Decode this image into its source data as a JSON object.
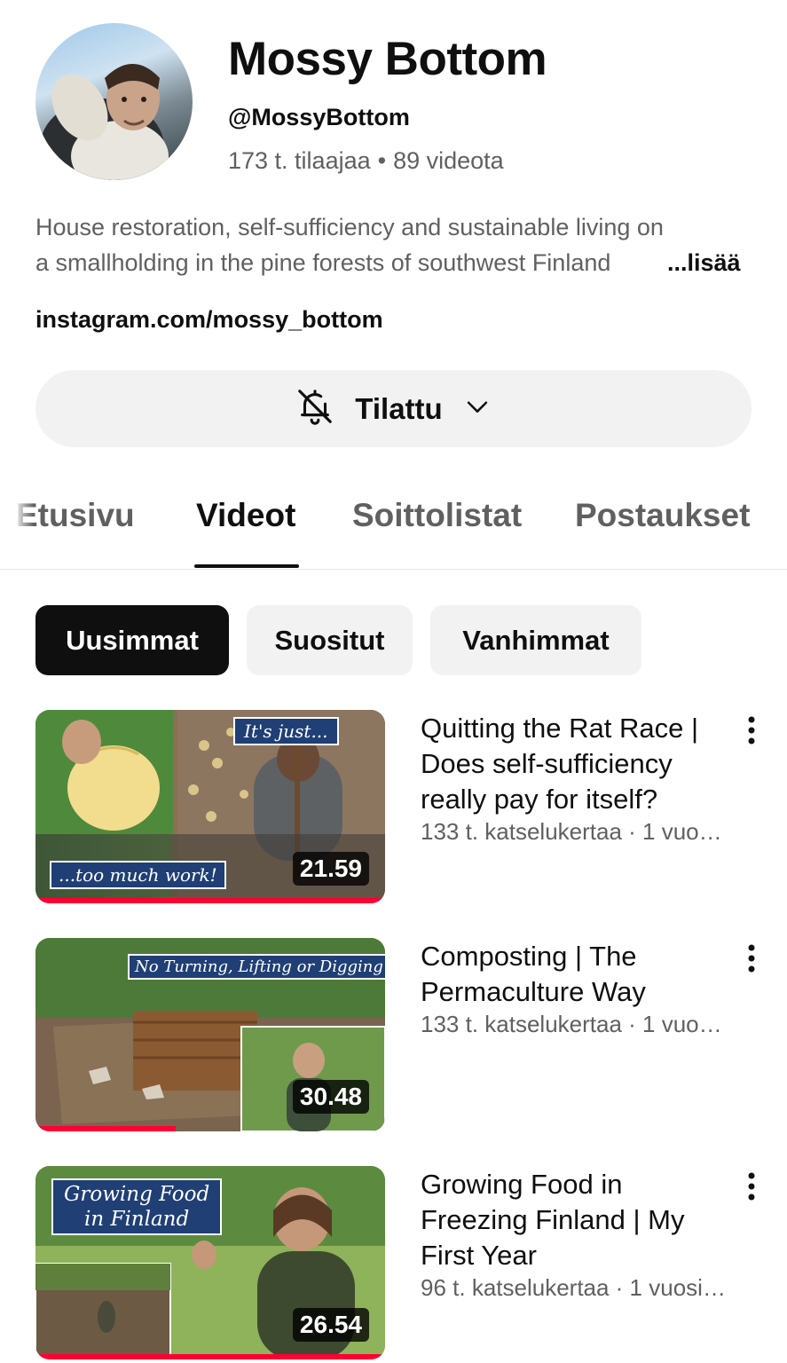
{
  "channel": {
    "name": "Mossy Bottom",
    "handle": "@MossyBottom",
    "subscribers": "173 t. tilaajaa",
    "videos": "89 videota",
    "stats_separator": "•",
    "description_line1": "House restoration, self-sufficiency and sustainable living on",
    "description_line2": "a smallholding in the pine forests of southwest Finland",
    "more_label": "...lisää",
    "link": "instagram.com/mossy_bottom"
  },
  "subscribe": {
    "label": "Tilattu",
    "icon": "bell-off-icon"
  },
  "tabs": [
    {
      "label": "Etusivu",
      "active": false
    },
    {
      "label": "Videot",
      "active": true
    },
    {
      "label": "Soittolistat",
      "active": false
    },
    {
      "label": "Postaukset",
      "active": false
    }
  ],
  "chips": [
    {
      "label": "Uusimmat",
      "selected": true
    },
    {
      "label": "Suositut",
      "selected": false
    },
    {
      "label": "Vanhimmat",
      "selected": false
    }
  ],
  "videos": [
    {
      "title": "Quitting the Rat Race | Does self-sufficiency really pay for itself?",
      "meta": "133 t. katselukertaa · 1 vuo…",
      "duration": "21.59",
      "thumb_caption_1": "It's just...",
      "thumb_caption_2": "...too much work!",
      "watched_fraction": 1.0
    },
    {
      "title": "Composting | The Permaculture Way",
      "meta": "133 t. katselukertaa · 1 vuo…",
      "duration": "30.48",
      "thumb_caption_1": "No Turning, Lifting or Digging",
      "watched_fraction": 0.4
    },
    {
      "title": "Growing Food in Freezing Finland | My First Year",
      "meta": "96 t. katselukertaa · 1 vuosi…",
      "duration": "26.54",
      "thumb_caption_1": "Growing Food",
      "thumb_caption_2": "in Finland",
      "watched_fraction": 1.0
    }
  ],
  "colors": {
    "accent": "#ff0033",
    "chip_bg": "#f2f2f2",
    "selected_chip": "#0f0f0f",
    "secondary_text": "#606060"
  }
}
